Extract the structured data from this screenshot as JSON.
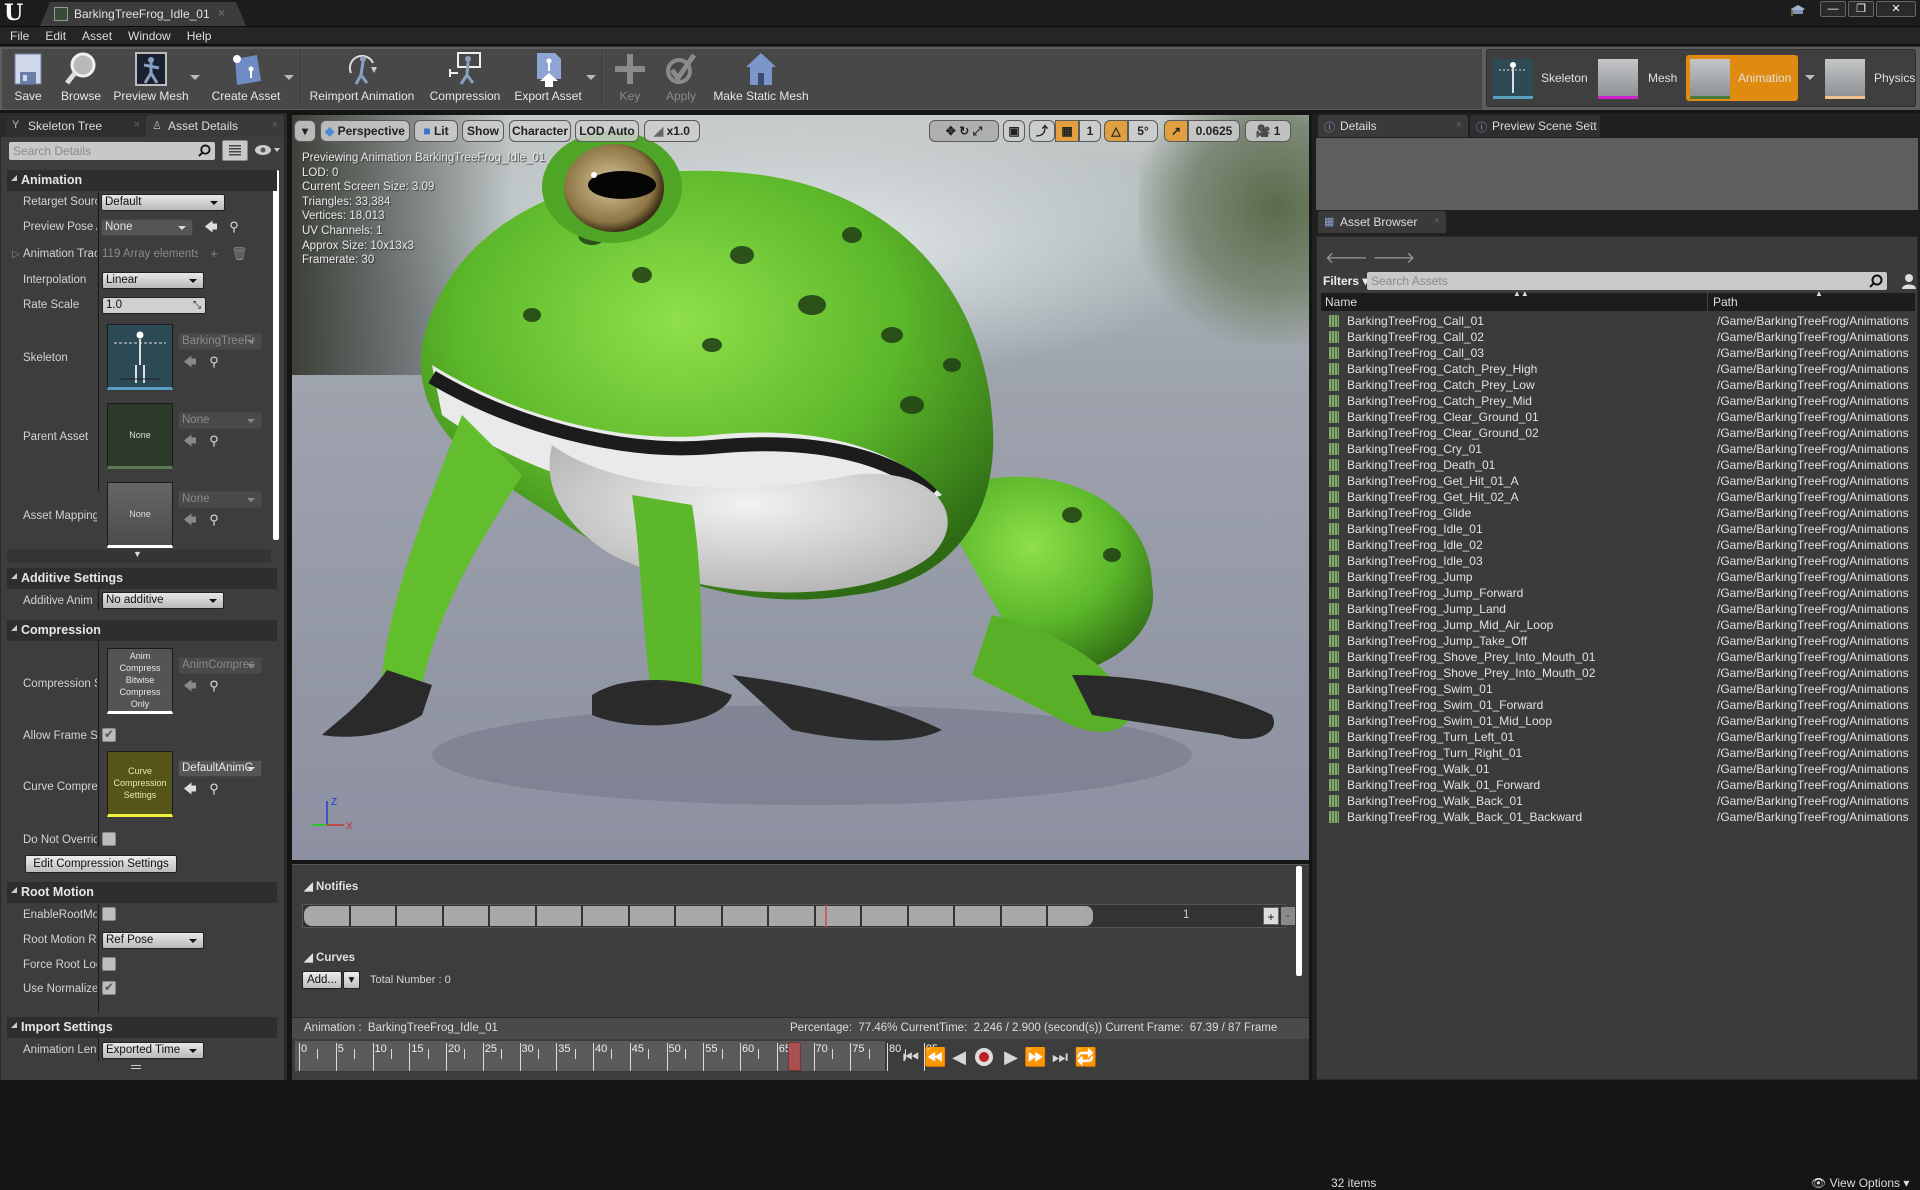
{
  "window": {
    "tab_title": "BarkingTreeFrog_Idle_01",
    "controls": {
      "minimize": "—",
      "restore": "❐",
      "close": "✕"
    }
  },
  "menu": [
    "File",
    "Edit",
    "Asset",
    "Window",
    "Help"
  ],
  "toolbar": {
    "buttons": [
      {
        "label": "Save",
        "icon": "save-icon"
      },
      {
        "label": "Browse",
        "icon": "browse-icon"
      },
      {
        "label": "Preview Mesh",
        "icon": "preview-mesh-icon"
      },
      {
        "label": "Create Asset",
        "icon": "create-asset-icon"
      },
      {
        "label": "Reimport Animation",
        "icon": "reimport-icon"
      },
      {
        "label": "Compression",
        "icon": "compression-icon"
      },
      {
        "label": "Export Asset",
        "icon": "export-icon"
      },
      {
        "label": "Key",
        "icon": "key-plus-icon",
        "disabled": true
      },
      {
        "label": "Apply",
        "icon": "apply-check-icon",
        "disabled": true
      },
      {
        "label": "Make Static Mesh",
        "icon": "static-mesh-icon"
      }
    ]
  },
  "modes": [
    {
      "label": "Skeleton",
      "accent": "#5aa0c0",
      "active": false
    },
    {
      "label": "Mesh",
      "accent": "#d020d0",
      "active": false
    },
    {
      "label": "Animation",
      "accent": "#4a7a3a",
      "active": true
    },
    {
      "label": "Physics",
      "accent": "#f0c090",
      "active": false
    }
  ],
  "left_panel": {
    "tabs": [
      {
        "label": "Skeleton Tree",
        "active": false
      },
      {
        "label": "Asset Details",
        "active": true
      }
    ],
    "search_placeholder": "Search Details",
    "sections": {
      "animation": {
        "title": "Animation",
        "retarget_source": {
          "label": "Retarget Sourc",
          "value": "Default"
        },
        "preview_pose": {
          "label": "Preview Pose A",
          "value": "None"
        },
        "animation_track": {
          "label": "Animation Trac",
          "value": "119 Array elements"
        },
        "interpolation": {
          "label": "Interpolation",
          "value": "Linear"
        },
        "rate_scale": {
          "label": "Rate Scale",
          "value": "1.0"
        },
        "skeleton": {
          "label": "Skeleton",
          "value": "BarkingTreeFr"
        },
        "parent_asset": {
          "label": "Parent Asset",
          "thumb": "None",
          "value": "None"
        },
        "asset_mapping": {
          "label": "Asset Mapping",
          "thumb": "None",
          "value": "None"
        }
      },
      "additive": {
        "title": "Additive Settings",
        "additive_anim": {
          "label": "Additive Anim",
          "value": "No additive"
        }
      },
      "compression": {
        "title": "Compression",
        "scheme": {
          "label": "Compression S",
          "thumb": "Anim Compress Bitwise Compress Only",
          "value": "AnimCompres"
        },
        "allow_frame": {
          "label": "Allow Frame St",
          "checked": true
        },
        "curve_compression": {
          "label": "Curve Compres",
          "thumb": "Curve Compression Settings",
          "value": "DefaultAnimC"
        },
        "do_not_override": {
          "label": "Do Not Overrid",
          "checked": false
        },
        "edit_button": "Edit Compression Settings"
      },
      "root_motion": {
        "title": "Root Motion",
        "enable": {
          "label": "EnableRootMot",
          "checked": false
        },
        "lock": {
          "label": "Root Motion Ro",
          "value": "Ref Pose"
        },
        "force_root": {
          "label": "Force Root Loc",
          "checked": false
        },
        "use_normalized": {
          "label": "Use Normalize",
          "checked": true
        }
      },
      "import": {
        "title": "Import Settings",
        "anim_length": {
          "label": "Animation Leng",
          "value": "Exported Time"
        }
      }
    }
  },
  "viewport": {
    "toolbar": {
      "perspective": "Perspective",
      "lit": "Lit",
      "show": "Show",
      "character": "Character",
      "lod": "LOD Auto",
      "speed": "x1.0",
      "grid_snap": "1",
      "rot_snap": "5°",
      "scale_snap": "0.0625",
      "camera_speed": "1"
    },
    "stats": [
      "Previewing Animation BarkingTreeFrog_Idle_01",
      "LOD: 0",
      "Current Screen Size: 3.09",
      "Triangles: 33,384",
      "Vertices: 18,013",
      "UV Channels: 1",
      "Approx Size: 10x13x3",
      "Framerate: 30"
    ],
    "axis": {
      "z": "Z",
      "x": "X"
    }
  },
  "right_panel": {
    "tabs": [
      {
        "label": "Details"
      },
      {
        "label": "Preview Scene Sett"
      }
    ],
    "asset_browser": {
      "tab_label": "Asset Browser",
      "filters_label": "Filters",
      "search_placeholder": "Search Assets",
      "columns": {
        "name": "Name",
        "path": "Path"
      },
      "items": [
        {
          "name": "BarkingTreeFrog_Call_01",
          "path": "/Game/BarkingTreeFrog/Animations"
        },
        {
          "name": "BarkingTreeFrog_Call_02",
          "path": "/Game/BarkingTreeFrog/Animations"
        },
        {
          "name": "BarkingTreeFrog_Call_03",
          "path": "/Game/BarkingTreeFrog/Animations"
        },
        {
          "name": "BarkingTreeFrog_Catch_Prey_High",
          "path": "/Game/BarkingTreeFrog/Animations"
        },
        {
          "name": "BarkingTreeFrog_Catch_Prey_Low",
          "path": "/Game/BarkingTreeFrog/Animations"
        },
        {
          "name": "BarkingTreeFrog_Catch_Prey_Mid",
          "path": "/Game/BarkingTreeFrog/Animations"
        },
        {
          "name": "BarkingTreeFrog_Clear_Ground_01",
          "path": "/Game/BarkingTreeFrog/Animations"
        },
        {
          "name": "BarkingTreeFrog_Clear_Ground_02",
          "path": "/Game/BarkingTreeFrog/Animations"
        },
        {
          "name": "BarkingTreeFrog_Cry_01",
          "path": "/Game/BarkingTreeFrog/Animations"
        },
        {
          "name": "BarkingTreeFrog_Death_01",
          "path": "/Game/BarkingTreeFrog/Animations"
        },
        {
          "name": "BarkingTreeFrog_Get_Hit_01_A",
          "path": "/Game/BarkingTreeFrog/Animations"
        },
        {
          "name": "BarkingTreeFrog_Get_Hit_02_A",
          "path": "/Game/BarkingTreeFrog/Animations"
        },
        {
          "name": "BarkingTreeFrog_Glide",
          "path": "/Game/BarkingTreeFrog/Animations"
        },
        {
          "name": "BarkingTreeFrog_Idle_01",
          "path": "/Game/BarkingTreeFrog/Animations"
        },
        {
          "name": "BarkingTreeFrog_Idle_02",
          "path": "/Game/BarkingTreeFrog/Animations"
        },
        {
          "name": "BarkingTreeFrog_Idle_03",
          "path": "/Game/BarkingTreeFrog/Animations"
        },
        {
          "name": "BarkingTreeFrog_Jump",
          "path": "/Game/BarkingTreeFrog/Animations"
        },
        {
          "name": "BarkingTreeFrog_Jump_Forward",
          "path": "/Game/BarkingTreeFrog/Animations"
        },
        {
          "name": "BarkingTreeFrog_Jump_Land",
          "path": "/Game/BarkingTreeFrog/Animations"
        },
        {
          "name": "BarkingTreeFrog_Jump_Mid_Air_Loop",
          "path": "/Game/BarkingTreeFrog/Animations"
        },
        {
          "name": "BarkingTreeFrog_Jump_Take_Off",
          "path": "/Game/BarkingTreeFrog/Animations"
        },
        {
          "name": "BarkingTreeFrog_Shove_Prey_Into_Mouth_01",
          "path": "/Game/BarkingTreeFrog/Animations"
        },
        {
          "name": "BarkingTreeFrog_Shove_Prey_Into_Mouth_02",
          "path": "/Game/BarkingTreeFrog/Animations"
        },
        {
          "name": "BarkingTreeFrog_Swim_01",
          "path": "/Game/BarkingTreeFrog/Animations"
        },
        {
          "name": "BarkingTreeFrog_Swim_01_Forward",
          "path": "/Game/BarkingTreeFrog/Animations"
        },
        {
          "name": "BarkingTreeFrog_Swim_01_Mid_Loop",
          "path": "/Game/BarkingTreeFrog/Animations"
        },
        {
          "name": "BarkingTreeFrog_Turn_Left_01",
          "path": "/Game/BarkingTreeFrog/Animations"
        },
        {
          "name": "BarkingTreeFrog_Turn_Right_01",
          "path": "/Game/BarkingTreeFrog/Animations"
        },
        {
          "name": "BarkingTreeFrog_Walk_01",
          "path": "/Game/BarkingTreeFrog/Animations"
        },
        {
          "name": "BarkingTreeFrog_Walk_01_Forward",
          "path": "/Game/BarkingTreeFrog/Animations"
        },
        {
          "name": "BarkingTreeFrog_Walk_Back_01",
          "path": "/Game/BarkingTreeFrog/Animations"
        },
        {
          "name": "BarkingTreeFrog_Walk_Back_01_Backward",
          "path": "/Game/BarkingTreeFrog/Animations"
        }
      ],
      "item_count": "32 items",
      "view_options": "View Options"
    }
  },
  "timeline": {
    "notifies_label": "Notifies",
    "notify_track_count": "1",
    "curves_label": "Curves",
    "add_label": "Add...",
    "total_number": "Total Number : 0",
    "status_animation": "Animation :  BarkingTreeFrog_Idle_01",
    "status_info": "Percentage:  77.46% CurrentTime:  2.246 / 2.900 (second(s)) Current Frame:  67.39 / 87 Frame",
    "total_frames": 87,
    "current_frame": 67.39,
    "tick_labels": [
      "0",
      "5",
      "10",
      "15",
      "20",
      "25",
      "30",
      "35",
      "40",
      "45",
      "50",
      "55",
      "60",
      "65",
      "70",
      "75",
      "80",
      "85"
    ]
  }
}
